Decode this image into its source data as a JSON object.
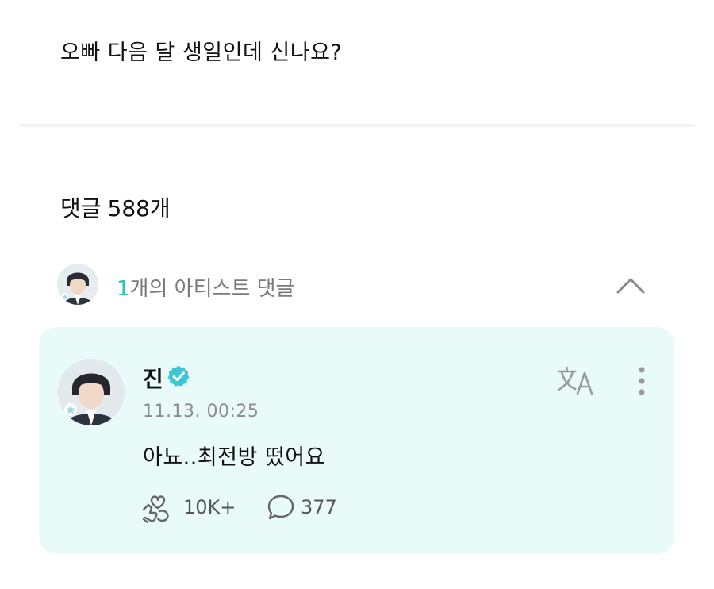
{
  "post": {
    "text": "오빠 다음 달 생일인데 신나요?"
  },
  "comments": {
    "label": "댓글",
    "count": "588개"
  },
  "artist_comments": {
    "count": "1",
    "label": "개의 아티스트 댓글",
    "chevron_icon": "chevron-up-icon"
  },
  "comment": {
    "author": "진",
    "verified_icon": "verified-badge-icon",
    "timestamp": "11.13. 00:25",
    "text": "아뇨..최전방 떴어요",
    "likes": "10K+",
    "replies": "377",
    "translate_icon": "translate-icon",
    "more_icon": "more-vertical-icon"
  },
  "colors": {
    "accent": "#36c2b4",
    "card_bg": "#e9fbf8",
    "muted": "#8c8c8c"
  }
}
